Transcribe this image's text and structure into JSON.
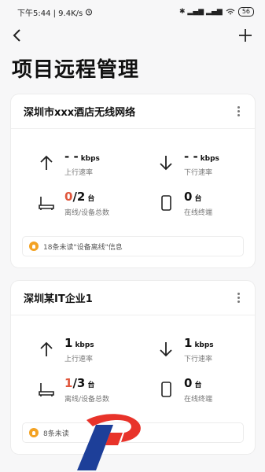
{
  "status_bar": {
    "time_speed": "下午5:44 | 9.4K/s",
    "signal": "✱ ▂▄▆ ▂▄▆",
    "battery": "56"
  },
  "nav": {
    "back_icon": "chevron-left-icon",
    "add_icon": "plus-icon"
  },
  "page_title": "项目远程管理",
  "cards": [
    {
      "title": "深圳市xxx酒店无线网络",
      "upload": {
        "value": "- -",
        "unit": "kbps",
        "label": "上行速率"
      },
      "download": {
        "value": "- -",
        "unit": "kbps",
        "label": "下行速率"
      },
      "devices": {
        "offline": "0",
        "total": "/2",
        "unit": "台",
        "label": "离线/设备总数"
      },
      "terminals": {
        "value": "0",
        "unit": "台",
        "label": "在线终端"
      },
      "notice": "18条未读\"设备离线\"信息"
    },
    {
      "title": "深圳某IT企业1",
      "upload": {
        "value": "1",
        "unit": "kbps",
        "label": "上行速率"
      },
      "download": {
        "value": "1",
        "unit": "kbps",
        "label": "下行速率"
      },
      "devices": {
        "offline": "1",
        "total": "/3",
        "unit": "台",
        "label": "离线/设备总数"
      },
      "terminals": {
        "value": "0",
        "unit": "台",
        "label": "在线终端"
      },
      "notice": "8条未读"
    }
  ],
  "colors": {
    "highlight": "#e0563c",
    "bell": "#f3a223",
    "logo_red": "#e8332a",
    "logo_blue": "#1d3f99"
  }
}
